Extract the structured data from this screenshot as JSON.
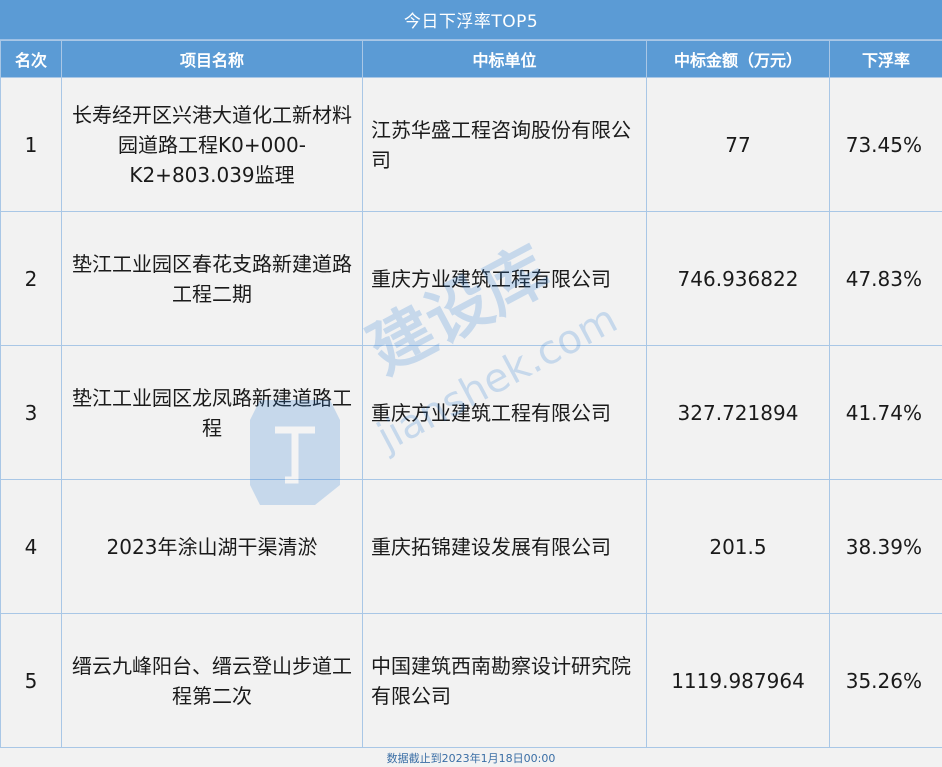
{
  "title": "今日下浮率TOP5",
  "headers": {
    "rank": "名次",
    "project": "项目名称",
    "winner": "中标单位",
    "amount": "中标金额（万元）",
    "rate": "下浮率"
  },
  "rows": [
    {
      "rank": "1",
      "project": "长寿经开区兴港大道化工新材料园道路工程K0+000-K2+803.039监理",
      "winner": "江苏华盛工程咨询股份有限公司",
      "amount": "77",
      "rate": "73.45%"
    },
    {
      "rank": "2",
      "project": "垫江工业园区春花支路新建道路工程二期",
      "winner": "重庆方业建筑工程有限公司",
      "amount": "746.936822",
      "rate": "47.83%"
    },
    {
      "rank": "3",
      "project": "垫江工业园区龙凤路新建道路工程",
      "winner": "重庆方业建筑工程有限公司",
      "amount": "327.721894",
      "rate": "41.74%"
    },
    {
      "rank": "4",
      "project": "2023年涂山湖干渠清淤",
      "winner": "重庆拓锦建设发展有限公司",
      "amount": "201.5",
      "rate": "38.39%"
    },
    {
      "rank": "5",
      "project": "缙云九峰阳台、缙云登山步道工程第二次",
      "winner": "中国建筑西南勘察设计研究院有限公司",
      "amount": "1119.987964",
      "rate": "35.26%"
    }
  ],
  "footer": "数据截止到2023年1月18日00:00",
  "watermark": {
    "text": "建设库",
    "sub": "jianshek.com",
    "icon": "jianshe-logo-icon"
  },
  "colors": {
    "header_bg": "#5b9bd5",
    "cell_bg": "#f2f2f2",
    "border": "#a9c7e6",
    "watermark": "#2f7fd6"
  }
}
